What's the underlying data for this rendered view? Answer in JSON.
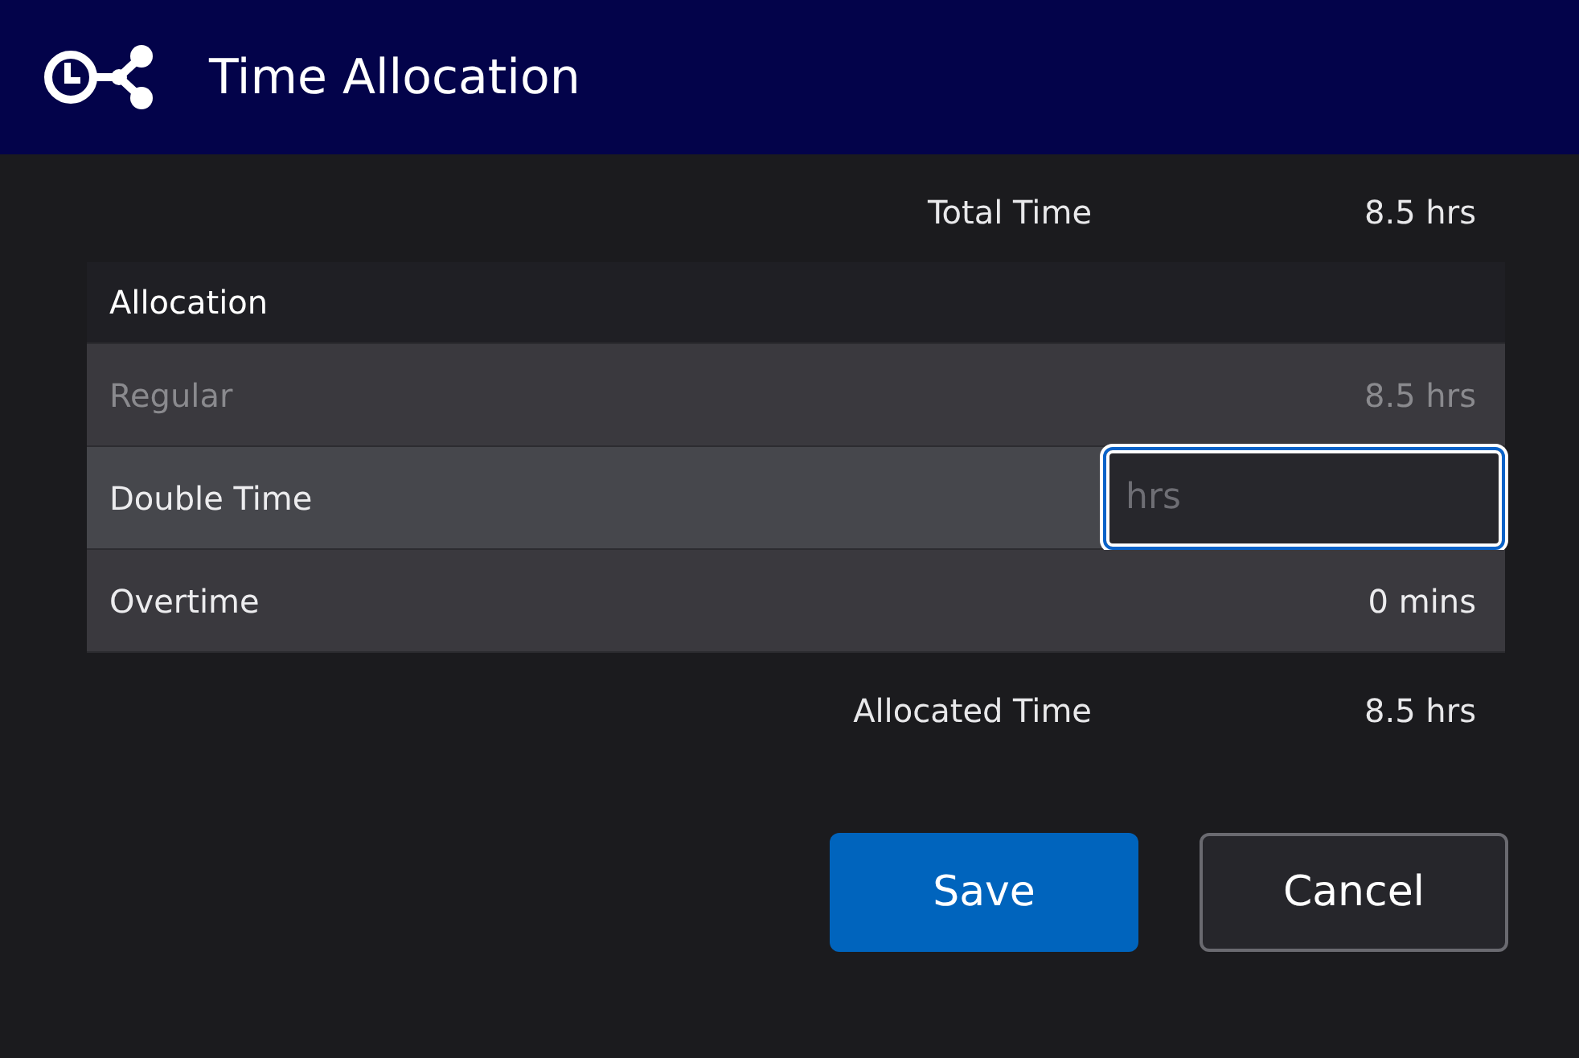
{
  "window": {
    "title": "Time Allocation"
  },
  "total": {
    "label": "Total Time",
    "value": "8.5 hrs"
  },
  "table": {
    "heading": "Allocation",
    "rows": [
      {
        "label": "Regular",
        "kind": "value",
        "value": "8.5 hrs",
        "disabled": true,
        "selected": false
      },
      {
        "label": "Double Time",
        "kind": "input",
        "placeholder": "hrs",
        "disabled": false,
        "selected": true
      },
      {
        "label": "Overtime",
        "kind": "value",
        "value": "0 mins",
        "disabled": false,
        "selected": false
      }
    ]
  },
  "allocated": {
    "label": "Allocated Time",
    "value": "8.5 hrs"
  },
  "buttons": [
    {
      "label": "Save",
      "kind": "primary"
    },
    {
      "label": "Cancel",
      "kind": "secondary"
    }
  ]
}
